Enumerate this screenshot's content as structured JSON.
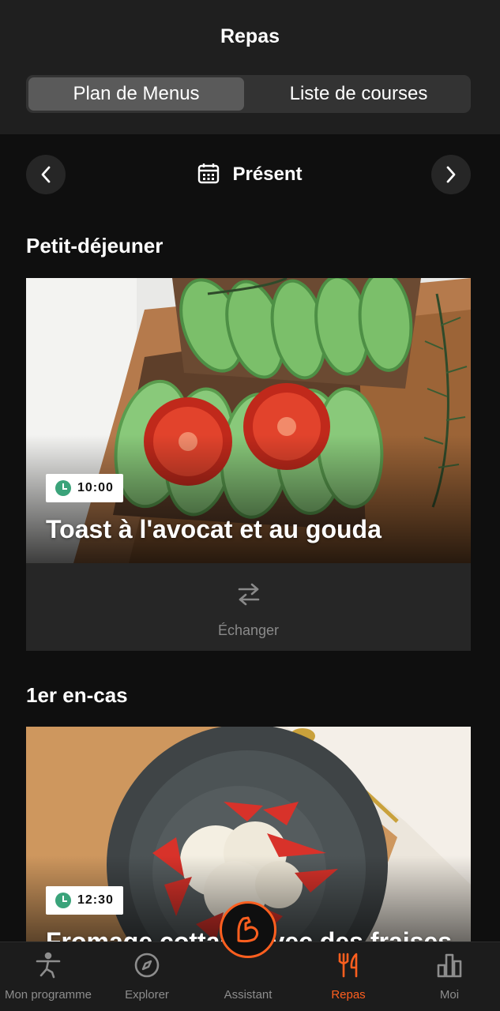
{
  "header": {
    "title": "Repas"
  },
  "segmented": {
    "active": "Plan de Menus",
    "inactive": "Liste de courses"
  },
  "date_nav": {
    "label": "Présent"
  },
  "meals": [
    {
      "section": "Petit-déjeuner",
      "time": "10:00",
      "name": "Toast à l'avocat et au gouda",
      "swap_label": "Échanger"
    },
    {
      "section": "1er en-cas",
      "time": "12:30",
      "name": "Fromage cottage avec des fraises"
    }
  ],
  "tabs": [
    {
      "label": "Mon programme",
      "icon": "person-stretch-icon"
    },
    {
      "label": "Explorer",
      "icon": "compass-icon"
    },
    {
      "label": "Assistant",
      "icon": "flex-arm-icon"
    },
    {
      "label": "Repas",
      "icon": "fork-knife-icon"
    },
    {
      "label": "Moi",
      "icon": "bar-chart-icon"
    }
  ],
  "colors": {
    "accent": "#ff5f1f",
    "clock": "#3aa37a",
    "background": "#0f0f0f"
  }
}
